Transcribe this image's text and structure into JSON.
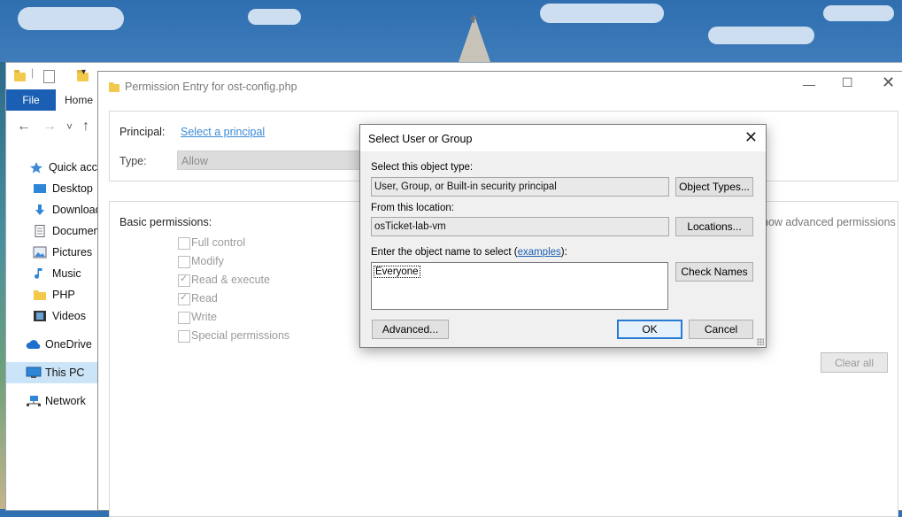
{
  "explorer": {
    "ribbon": {
      "file_tab": "File",
      "home_tab": "Home"
    },
    "nav": {
      "back": "←",
      "forward": "→",
      "dropdown": "˅",
      "up": "↑"
    },
    "tree": [
      {
        "label": "Quick access",
        "icon": "star-icon"
      },
      {
        "label": "Desktop",
        "icon": "desktop-icon"
      },
      {
        "label": "Downloads",
        "icon": "download-icon"
      },
      {
        "label": "Documents",
        "icon": "document-icon"
      },
      {
        "label": "Pictures",
        "icon": "pictures-icon"
      },
      {
        "label": "Music",
        "icon": "music-icon"
      },
      {
        "label": "PHP",
        "icon": "folder-icon"
      },
      {
        "label": "Videos",
        "icon": "videos-icon"
      },
      {
        "label": "OneDrive",
        "icon": "cloud-icon"
      },
      {
        "label": "This PC",
        "icon": "computer-icon"
      },
      {
        "label": "Network",
        "icon": "network-icon"
      }
    ]
  },
  "permission_entry": {
    "title": "Permission Entry for ost-config.php",
    "principal_label": "Principal:",
    "principal_link": "Select a principal",
    "type_label": "Type:",
    "type_value": "Allow",
    "basic_permissions_label": "Basic permissions:",
    "show_advanced_link": "how advanced permissions",
    "permissions": [
      {
        "label": "Full control",
        "checked": false
      },
      {
        "label": "Modify",
        "checked": false
      },
      {
        "label": "Read & execute",
        "checked": true
      },
      {
        "label": "Read",
        "checked": true
      },
      {
        "label": "Write",
        "checked": false
      },
      {
        "label": "Special permissions",
        "checked": false
      }
    ],
    "clear_all": "Clear all"
  },
  "select_user_dialog": {
    "title": "Select User or Group",
    "object_type_label": "Select this object type:",
    "object_type_value": "User, Group, or Built-in security principal",
    "object_types_button": "Object Types...",
    "location_label": "From this location:",
    "location_value": "osTicket-lab-vm",
    "locations_button": "Locations...",
    "enter_name_label_prefix": "Enter the object name to select (",
    "examples_link": "examples",
    "enter_name_label_suffix": "):",
    "object_name_value": "Everyone",
    "check_names_button": "Check Names",
    "advanced_button": "Advanced...",
    "ok_button": "OK",
    "cancel_button": "Cancel"
  }
}
